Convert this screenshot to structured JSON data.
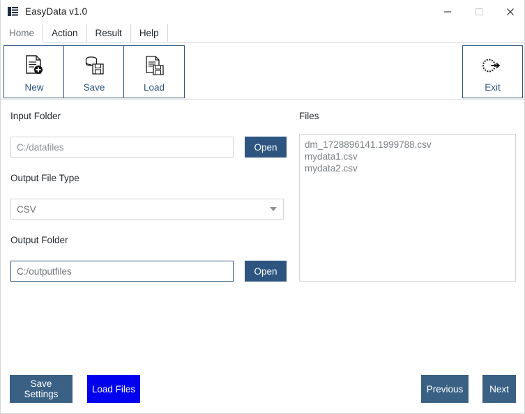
{
  "window": {
    "title": "EasyData v1.0",
    "app_icon": "easydata-app-icon",
    "controls": {
      "minimize": "minimize-icon",
      "maximize": "maximize-icon",
      "close": "close-icon"
    }
  },
  "menubar": {
    "tabs": [
      {
        "label": "Home",
        "active": true
      },
      {
        "label": "Action",
        "active": false
      },
      {
        "label": "Result",
        "active": false
      },
      {
        "label": "Help",
        "active": false
      }
    ]
  },
  "ribbon": {
    "buttons": [
      {
        "label": "New",
        "icon": "new-document-icon"
      },
      {
        "label": "Save",
        "icon": "database-save-icon"
      },
      {
        "label": "Load",
        "icon": "document-load-icon"
      },
      {
        "label": "Exit",
        "icon": "exit-door-icon"
      }
    ]
  },
  "form": {
    "input_folder": {
      "label": "Input Folder",
      "value": "C:/datafiles",
      "placeholder": "C:/datafiles",
      "open_label": "Open",
      "focused": false
    },
    "output_file_type": {
      "label": "Output File Type",
      "selected": "CSV",
      "options": [
        "CSV"
      ]
    },
    "output_folder": {
      "label": "Output Folder",
      "value": "C:/outputfiles",
      "placeholder": "C:/outputfiles",
      "open_label": "Open",
      "focused": true
    }
  },
  "files_panel": {
    "label": "Files",
    "items": [
      "dm_1728896141.1999788.csv",
      "mydata1.csv",
      "mydata2.csv"
    ]
  },
  "footer": {
    "save_settings_label": "Save Settings",
    "load_files_label": "Load Files",
    "previous_label": "Previous",
    "next_label": "Next"
  },
  "colors": {
    "accent": "#2d5580",
    "footer_button": "#3a6084",
    "highlight_button": "#0000ee",
    "text": "#24292e",
    "muted_text": "#7b8084",
    "border": "#d2d2d2"
  }
}
